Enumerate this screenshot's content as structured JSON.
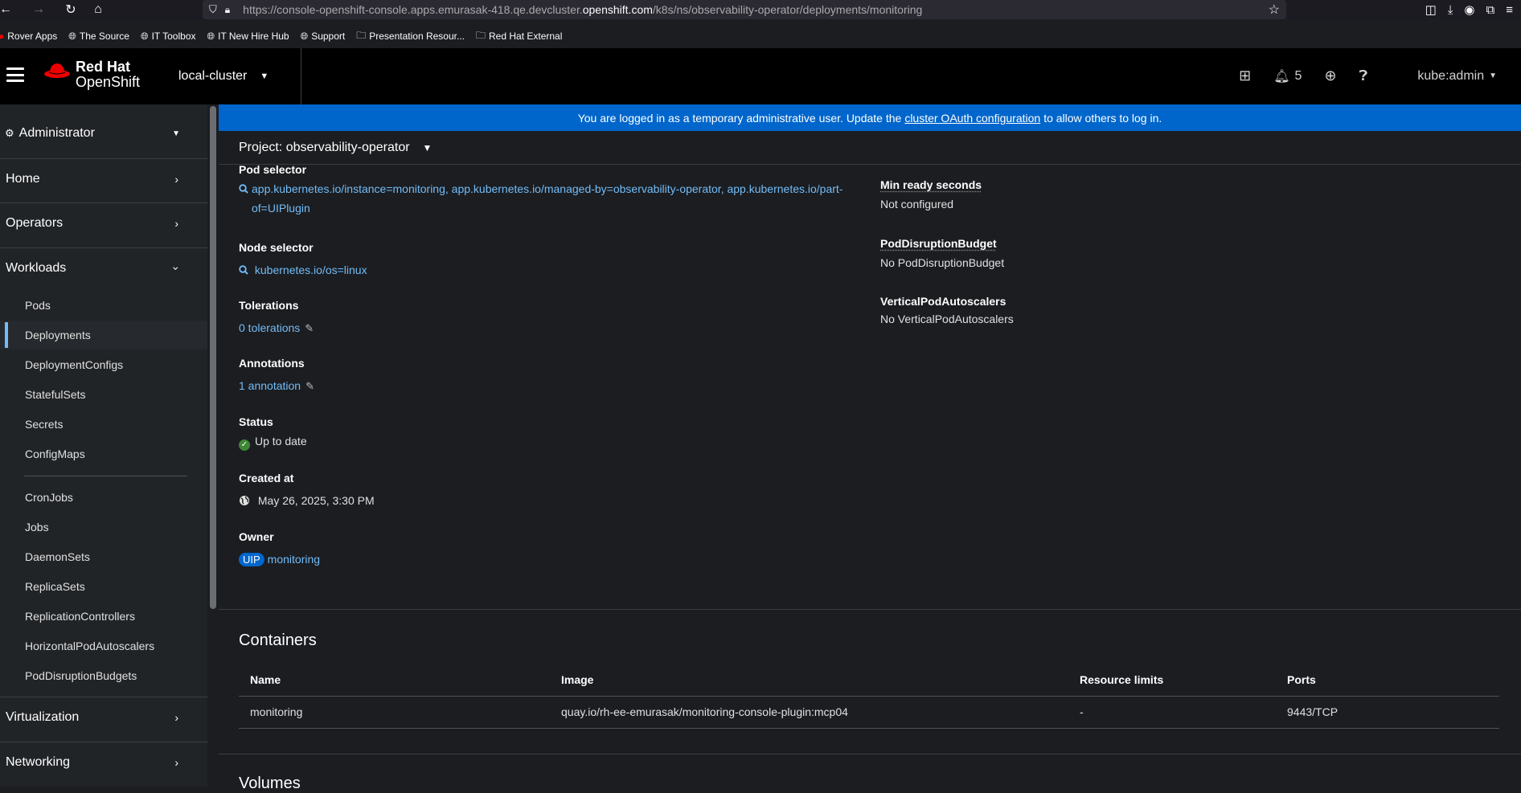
{
  "browser": {
    "url_prefix": "https://console-openshift-console.apps.emurasak-418.qe.devcluster.",
    "url_domain": "openshift.com",
    "url_suffix": "/k8s/ns/observability-operator/deployments/monitoring"
  },
  "bookmarks": [
    {
      "label": "Rover Apps",
      "icon": "rover-icon"
    },
    {
      "label": "The Source",
      "icon": "globe-icon"
    },
    {
      "label": "IT Toolbox",
      "icon": "globe-icon"
    },
    {
      "label": "IT New Hire Hub",
      "icon": "globe-icon"
    },
    {
      "label": "Support",
      "icon": "globe-icon"
    },
    {
      "label": "Presentation Resour...",
      "icon": "folder-icon"
    },
    {
      "label": "Red Hat External",
      "icon": "folder-icon"
    }
  ],
  "masthead": {
    "brand_line1": "Red Hat",
    "brand_line2": "OpenShift",
    "cluster": "local-cluster",
    "notifications_count": "5",
    "user": "kube:admin"
  },
  "sidebar": {
    "perspective": "Administrator",
    "sections": {
      "home": "Home",
      "operators": "Operators",
      "workloads": "Workloads",
      "virtualization": "Virtualization",
      "networking": "Networking"
    },
    "workloads_items": [
      "Pods",
      "Deployments",
      "DeploymentConfigs",
      "StatefulSets",
      "Secrets",
      "ConfigMaps",
      "CronJobs",
      "Jobs",
      "DaemonSets",
      "ReplicaSets",
      "ReplicationControllers",
      "HorizontalPodAutoscalers",
      "PodDisruptionBudgets"
    ],
    "active_item": "Deployments"
  },
  "banner": {
    "text_before": "You are logged in as a temporary administrative user. Update the",
    "link": "cluster OAuth configuration",
    "text_after": "to allow others to log in."
  },
  "project_bar": {
    "label": "Project: observability-operator"
  },
  "details_left": {
    "pod_selector": {
      "label": "Pod selector",
      "value": "app.kubernetes.io/instance=monitoring, app.kubernetes.io/managed-by=observability-operator, app.kubernetes.io/part-of=UIPlugin"
    },
    "node_selector": {
      "label": "Node selector",
      "value": "kubernetes.io/os=linux"
    },
    "tolerations": {
      "label": "Tolerations",
      "value": "0 tolerations"
    },
    "annotations": {
      "label": "Annotations",
      "value": "1 annotation"
    },
    "status": {
      "label": "Status",
      "value": "Up to date"
    },
    "created_at": {
      "label": "Created at",
      "value": "May 26, 2025, 3:30 PM"
    },
    "owner": {
      "label": "Owner",
      "badge": "UIP",
      "value": "monitoring"
    }
  },
  "details_right": {
    "min_ready": {
      "label": "Min ready seconds",
      "value": "Not configured"
    },
    "pdb": {
      "label": "PodDisruptionBudget",
      "value": "No PodDisruptionBudget"
    },
    "vpa": {
      "label": "VerticalPodAutoscalers",
      "value": "No VerticalPodAutoscalers"
    }
  },
  "containers": {
    "title": "Containers",
    "columns": [
      "Name",
      "Image",
      "Resource limits",
      "Ports"
    ],
    "rows": [
      [
        "monitoring",
        "quay.io/rh-ee-emurasak/monitoring-console-plugin:mcp04",
        "-",
        "9443/TCP"
      ]
    ]
  },
  "volumes": {
    "title": "Volumes"
  },
  "colors": {
    "accent": "#73bcf7",
    "banner": "#0066cc",
    "success": "#3e8635",
    "background": "#1b1d21"
  }
}
